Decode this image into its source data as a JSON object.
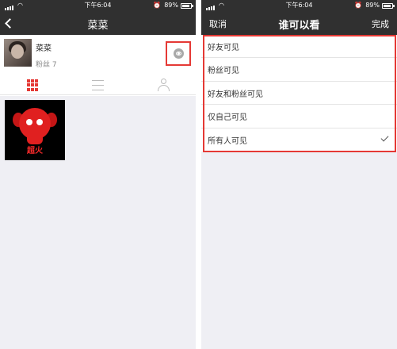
{
  "status_bar": {
    "time": "下午6:04",
    "battery": "89%"
  },
  "left_screen": {
    "title": "菜菜",
    "profile": {
      "name": "菜菜",
      "fans": "粉丝 7"
    },
    "tabs": [
      "grid-icon",
      "list-icon",
      "person-icon"
    ],
    "post_caption": "超火"
  },
  "right_screen": {
    "title": "谁可以看",
    "cancel": "取消",
    "done": "完成",
    "options": [
      {
        "label": "好友可见",
        "checked": false
      },
      {
        "label": "粉丝可见",
        "checked": false
      },
      {
        "label": "好友和粉丝可见",
        "checked": false
      },
      {
        "label": "仅自己可见",
        "checked": false
      },
      {
        "label": "所有人可见",
        "checked": true
      }
    ]
  },
  "colors": {
    "nav_bg": "#303030",
    "accent": "#e53935",
    "page_bg": "#efeff4"
  }
}
